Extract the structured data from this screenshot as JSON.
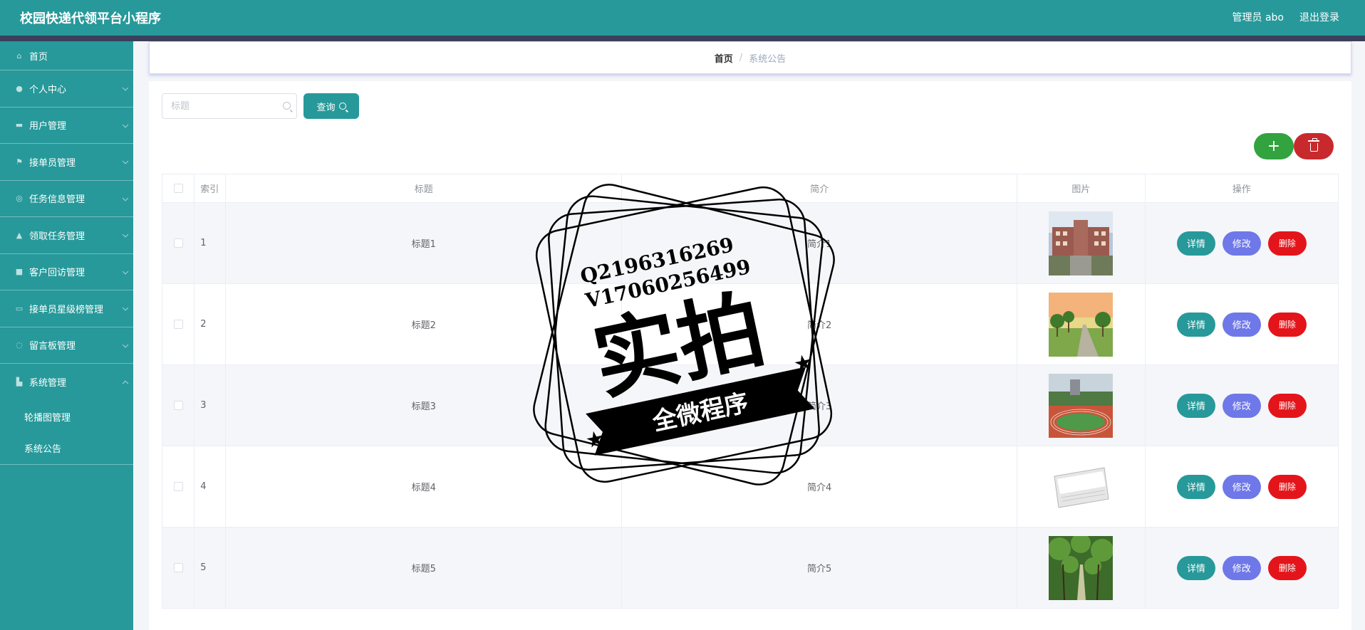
{
  "header": {
    "title": "校园快递代领平台小程序",
    "user": "管理员 abo",
    "logout": "退出登录"
  },
  "sidebar": {
    "items": [
      {
        "label": "首页",
        "icon": "home-icon",
        "caret": false
      },
      {
        "label": "个人中心",
        "icon": "user-icon",
        "caret": true
      },
      {
        "label": "用户管理",
        "icon": "users-icon",
        "caret": true
      },
      {
        "label": "接单员管理",
        "icon": "flag-icon",
        "caret": true
      },
      {
        "label": "任务信息管理",
        "icon": "compass-icon",
        "caret": true
      },
      {
        "label": "领取任务管理",
        "icon": "person-icon",
        "caret": true
      },
      {
        "label": "客户回访管理",
        "icon": "clipboard-icon",
        "caret": true
      },
      {
        "label": "接单员星级榜管理",
        "icon": "chart-icon",
        "caret": true
      },
      {
        "label": "留言板管理",
        "icon": "bell-icon",
        "caret": true
      },
      {
        "label": "系统管理",
        "icon": "settings-icon",
        "caret": true
      }
    ],
    "sub_items": [
      {
        "label": "轮播图管理"
      },
      {
        "label": "系统公告"
      }
    ]
  },
  "breadcrumb": {
    "home": "首页",
    "separator": "/",
    "current": "系统公告"
  },
  "search": {
    "placeholder": "标题",
    "button": "查询"
  },
  "actions": {
    "add": "+"
  },
  "table": {
    "columns": [
      "索引",
      "标题",
      "简介",
      "图片",
      "操作"
    ],
    "rows": [
      {
        "index": "1",
        "title": "标题1",
        "intro": "简介1",
        "image": "campus-building"
      },
      {
        "index": "2",
        "title": "标题2",
        "intro": "简介2",
        "image": "campus-road"
      },
      {
        "index": "3",
        "title": "标题3",
        "intro": "简介3",
        "image": "running-track"
      },
      {
        "index": "4",
        "title": "标题4",
        "intro": "简介4",
        "image": "news-paper"
      },
      {
        "index": "5",
        "title": "标题5",
        "intro": "简介5",
        "image": "tree-lane"
      }
    ],
    "row_actions": {
      "detail": "详情",
      "edit": "修改",
      "delete": "删除"
    }
  },
  "watermark": {
    "line1": "Q2196316269",
    "line2": "V17060256499",
    "main": "实拍",
    "ribbon": "全微程序"
  },
  "colors": {
    "primary": "#27999a",
    "add": "#32a33e",
    "delete": "#c8292d",
    "edit": "#6f78e8",
    "remove": "#e4151a"
  }
}
